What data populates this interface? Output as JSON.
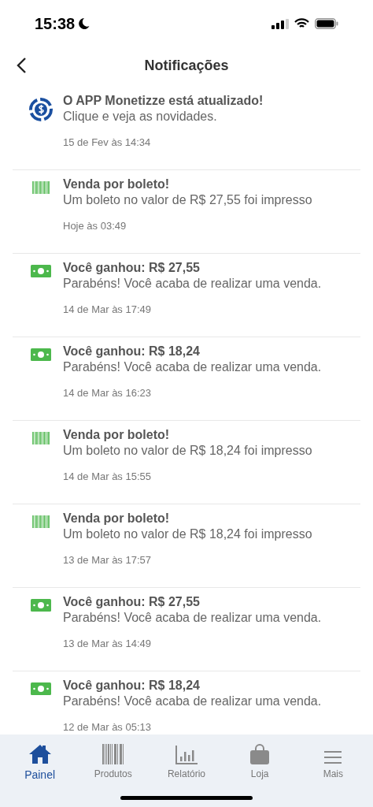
{
  "status_bar": {
    "time": "15:38"
  },
  "header": {
    "title": "Notificações"
  },
  "notifications": [
    {
      "kind": "app",
      "title": "O APP Monetizze está atualizado!",
      "text": "Clique e veja as novidades.",
      "date": "15 de Fev às 14:34"
    },
    {
      "kind": "boleto",
      "title": "Venda por boleto!",
      "text": "Um boleto no valor de R$ 27,55 foi impresso",
      "date": "Hoje às 03:49"
    },
    {
      "kind": "money",
      "title": "Você ganhou: R$ 27,55",
      "text": "Parabéns! Você acaba de realizar uma venda.",
      "date": "14 de Mar às 17:49"
    },
    {
      "kind": "money",
      "title": "Você ganhou: R$ 18,24",
      "text": "Parabéns! Você acaba de realizar uma venda.",
      "date": "14 de Mar às 16:23"
    },
    {
      "kind": "boleto",
      "title": "Venda por boleto!",
      "text": "Um boleto no valor de R$ 18,24 foi impresso",
      "date": "14 de Mar às 15:55"
    },
    {
      "kind": "boleto",
      "title": "Venda por boleto!",
      "text": "Um boleto no valor de R$ 18,24 foi impresso",
      "date": "13 de Mar às 17:57"
    },
    {
      "kind": "money",
      "title": "Você ganhou: R$ 27,55",
      "text": "Parabéns! Você acaba de realizar uma venda.",
      "date": "13 de Mar às 14:49"
    },
    {
      "kind": "money",
      "title": "Você ganhou: R$ 18,24",
      "text": "Parabéns! Você acaba de realizar uma venda.",
      "date": "12 de Mar às 05:13"
    }
  ],
  "tab_bar": [
    {
      "kind": "home",
      "label": "Painel",
      "selected": true
    },
    {
      "kind": "barcode",
      "label": "Produtos",
      "selected": false
    },
    {
      "kind": "chart",
      "label": "Relatório",
      "selected": false
    },
    {
      "kind": "bag",
      "label": "Loja",
      "selected": false
    },
    {
      "kind": "menu",
      "label": "Mais",
      "selected": false
    }
  ]
}
